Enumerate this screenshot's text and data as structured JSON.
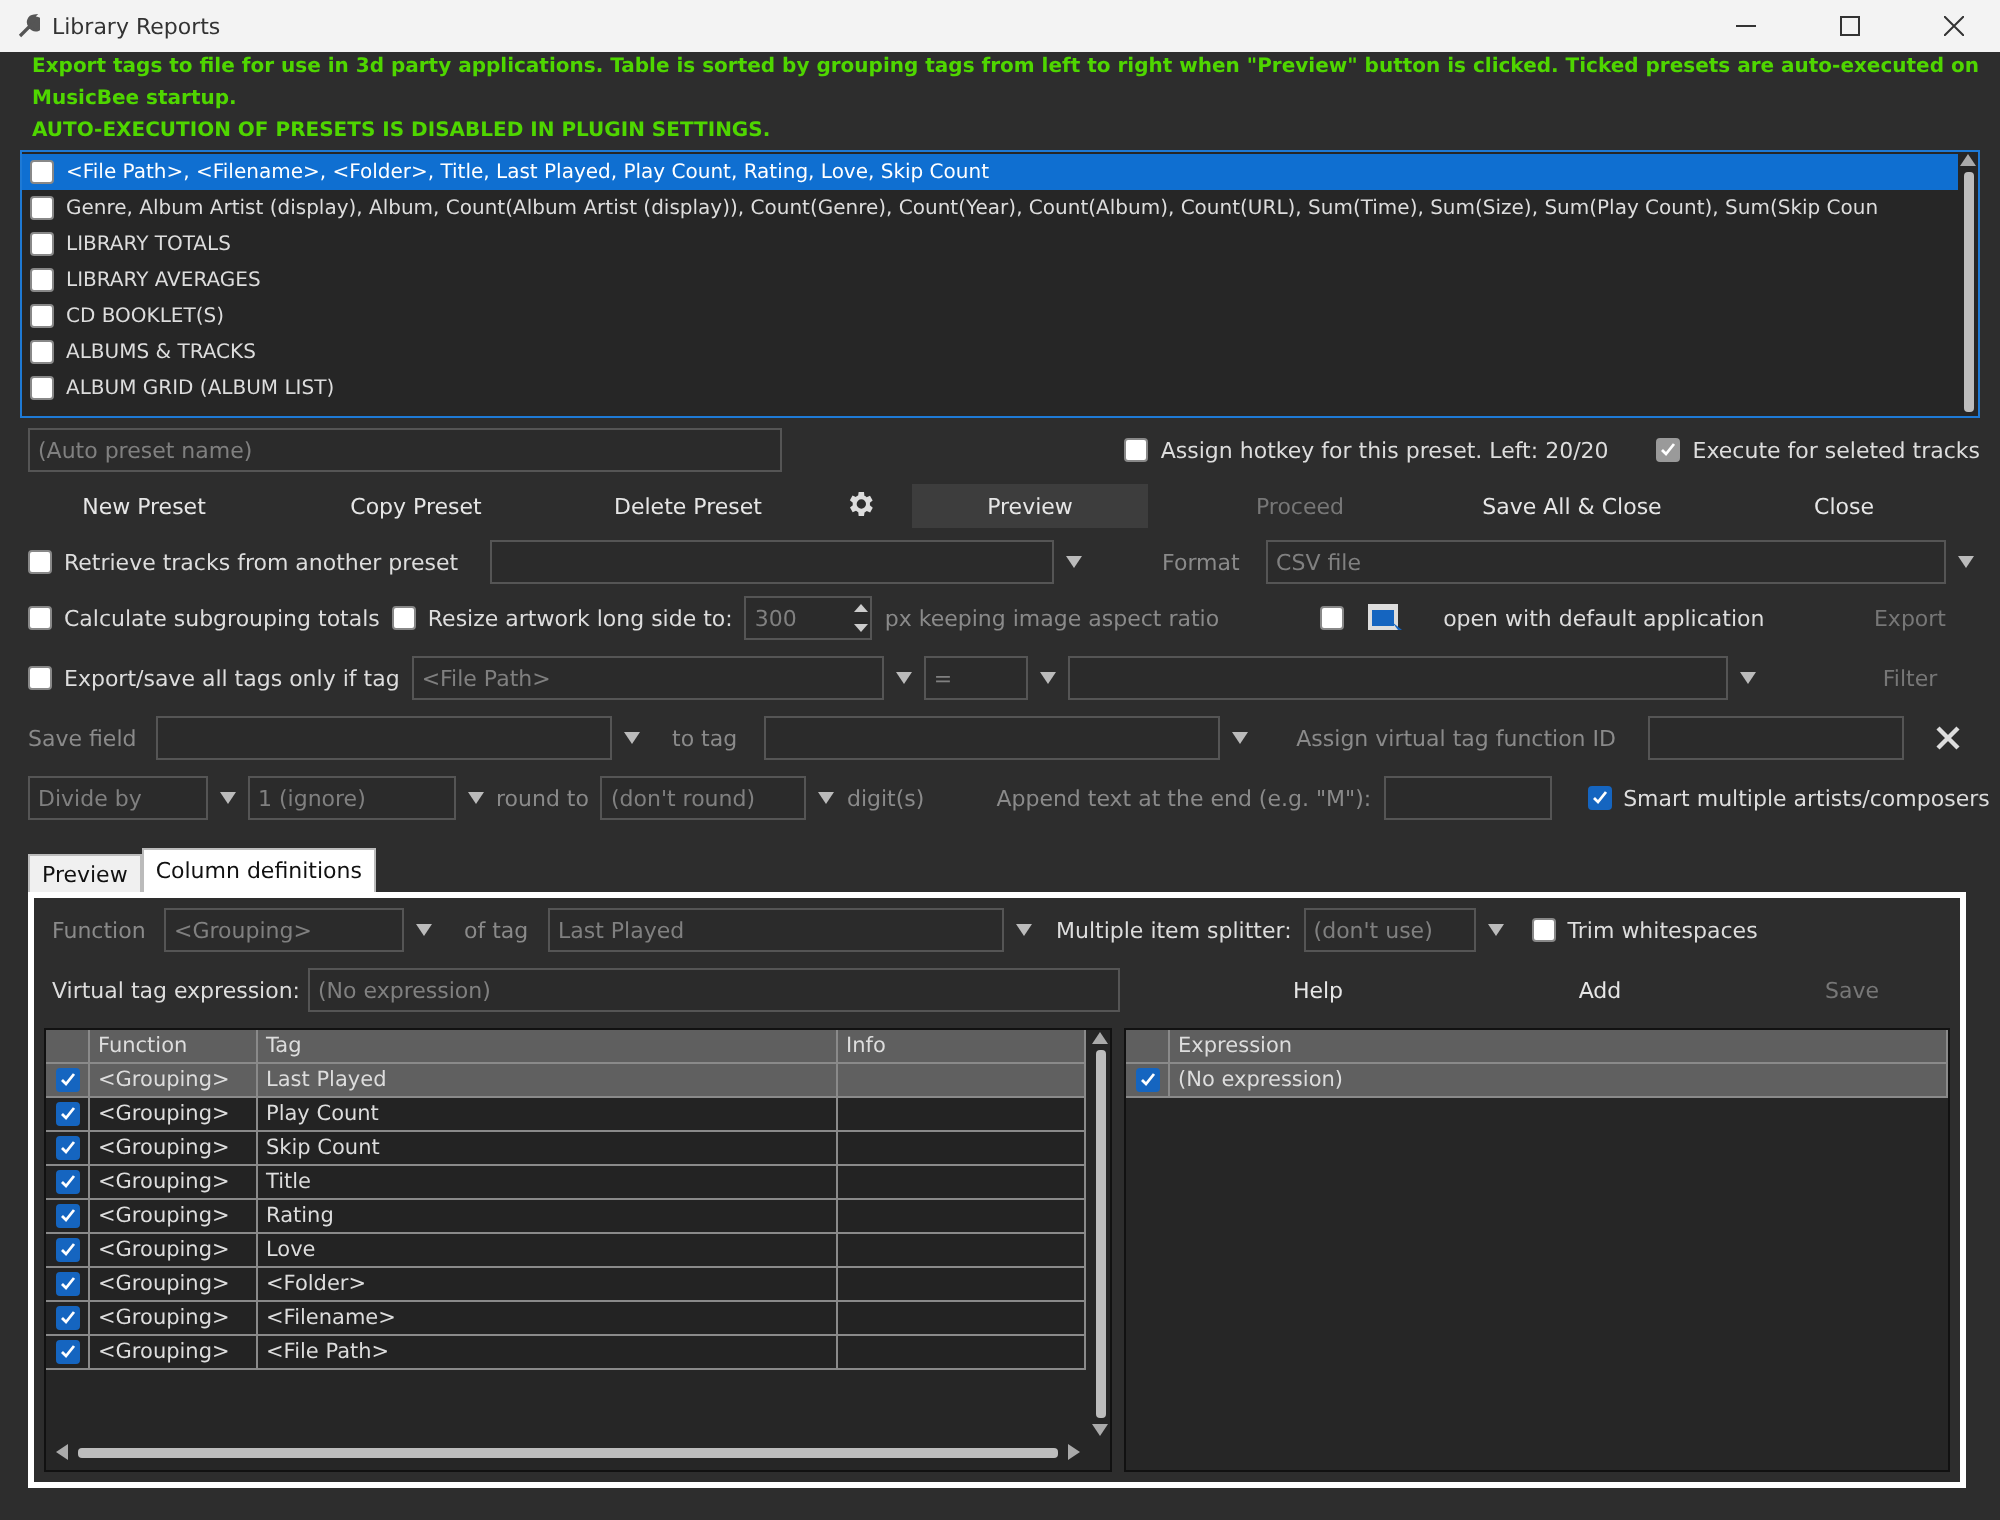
{
  "window": {
    "title": "Library Reports"
  },
  "info": {
    "description": "Export tags to file for use in 3d party applications. Table is sorted by grouping tags from left to right when \"Preview\" button is clicked. Ticked presets are auto-executed on MusicBee startup.",
    "warning": "AUTO-EXECUTION OF PRESETS IS DISABLED IN PLUGIN SETTINGS."
  },
  "presets": [
    {
      "label": "<File Path>, <Filename>, <Folder>, Title, Last Played, Play Count, Rating, Love, Skip Count",
      "checked": false,
      "selected": true
    },
    {
      "label": "Genre, Album Artist (display), Album, Count(Album Artist (display)), Count(Genre), Count(Year), Count(Album), Count(URL), Sum(Time), Sum(Size), Sum(Play Count), Sum(Skip Coun",
      "checked": false,
      "selected": false
    },
    {
      "label": "LIBRARY TOTALS",
      "checked": false,
      "selected": false
    },
    {
      "label": "LIBRARY AVERAGES",
      "checked": false,
      "selected": false
    },
    {
      "label": "CD BOOKLET(S)",
      "checked": false,
      "selected": false
    },
    {
      "label": "ALBUMS & TRACKS",
      "checked": false,
      "selected": false
    },
    {
      "label": "ALBUM GRID (ALBUM LIST)",
      "checked": false,
      "selected": false
    }
  ],
  "preset_name": {
    "placeholder": "(Auto preset name)"
  },
  "hotkey": {
    "label": "Assign hotkey for this preset. Left: 20/20",
    "checked": false
  },
  "execute_selected": {
    "label": "Execute for seleted tracks",
    "checked": true,
    "disabled": true
  },
  "buttons": [
    {
      "kind": "text",
      "label": "New Preset",
      "disabled": false
    },
    {
      "kind": "text",
      "label": "Copy Preset",
      "disabled": false
    },
    {
      "kind": "text",
      "label": "Delete Preset",
      "disabled": false
    },
    {
      "kind": "gear"
    },
    {
      "kind": "primary",
      "label": "Preview",
      "disabled": false
    },
    {
      "kind": "text",
      "label": "Proceed",
      "disabled": true
    },
    {
      "kind": "text",
      "label": "Save All & Close",
      "disabled": false
    },
    {
      "kind": "text",
      "label": "Close",
      "disabled": false
    }
  ],
  "retrieve": {
    "label": "Retrieve tracks from another preset",
    "checked": false,
    "format_label": "Format",
    "format": "CSV file"
  },
  "subgrouping": {
    "label": "Calculate subgrouping totals",
    "checked": false
  },
  "resize": {
    "label": "Resize artwork long side to:",
    "checked": false,
    "size": "300",
    "suffix": "px keeping image aspect ratio"
  },
  "open_default": {
    "label": "open with default application",
    "checked": false
  },
  "export_button": {
    "label": "Export",
    "disabled": true
  },
  "tag_filter": {
    "label": "Export/save all tags only if tag",
    "checked": false,
    "tag": "<File Path>",
    "operator": "=",
    "filter_button": "Filter"
  },
  "save_field": {
    "label": "Save field",
    "to_tag": "to tag",
    "assign_label": "Assign virtual tag function ID"
  },
  "number_format": {
    "divide": "Divide by",
    "divisor": "1 (ignore)",
    "round_label": "round to",
    "round": "(don't round)",
    "digits": "digit(s)",
    "append_label": "Append text at the end (e.g. \"M\"):",
    "smart": {
      "label": "Smart multiple artists/composers",
      "checked": true
    }
  },
  "tabs": [
    {
      "label": "Preview",
      "selected": false
    },
    {
      "label": "Column definitions",
      "selected": true
    }
  ],
  "column_editor": {
    "function_label": "Function",
    "function": "<Grouping>",
    "of_tag": "of tag",
    "tag": "Last Played",
    "splitter_label": "Multiple item splitter:",
    "splitter": "(don't use)",
    "trim": {
      "label": "Trim whitespaces",
      "checked": false
    },
    "expression_label": "Virtual tag expression:",
    "expression_placeholder": "(No expression)",
    "actions": [
      {
        "label": "Help",
        "disabled": false
      },
      {
        "label": "Add",
        "disabled": false
      },
      {
        "label": "Save",
        "disabled": true
      }
    ]
  },
  "columns_table": {
    "columns": [
      "Function",
      "Tag",
      "Info"
    ],
    "rows": [
      {
        "function": "<Grouping>",
        "tag": "Last Played",
        "checked": true,
        "selected": true
      },
      {
        "function": "<Grouping>",
        "tag": "Play Count",
        "checked": true,
        "selected": false
      },
      {
        "function": "<Grouping>",
        "tag": "Skip Count",
        "checked": true,
        "selected": false
      },
      {
        "function": "<Grouping>",
        "tag": "Title",
        "checked": true,
        "selected": false
      },
      {
        "function": "<Grouping>",
        "tag": "Rating",
        "checked": true,
        "selected": false
      },
      {
        "function": "<Grouping>",
        "tag": "Love",
        "checked": true,
        "selected": false
      },
      {
        "function": "<Grouping>",
        "tag": "<Folder>",
        "checked": true,
        "selected": false
      },
      {
        "function": "<Grouping>",
        "tag": "<Filename>",
        "checked": true,
        "selected": false
      },
      {
        "function": "<Grouping>",
        "tag": "<File Path>",
        "checked": true,
        "selected": false
      }
    ]
  },
  "expressions_table": {
    "columns": [
      "Expression"
    ],
    "rows": [
      {
        "text": "(No expression)",
        "checked": true,
        "selected": true
      }
    ]
  }
}
